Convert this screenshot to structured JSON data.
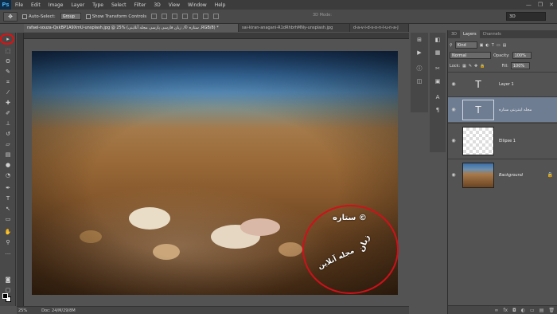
{
  "app": {
    "logo": "Ps"
  },
  "menu": [
    "File",
    "Edit",
    "Image",
    "Layer",
    "Type",
    "Select",
    "Filter",
    "3D",
    "View",
    "Window",
    "Help"
  ],
  "window_controls": [
    "—",
    "❐",
    "✕"
  ],
  "options_bar": {
    "auto_select_label": "Auto-Select:",
    "auto_select_value": "Group",
    "show_transform_label": "Show Transform Controls",
    "mode_3d_label": "3D Mode:",
    "workspace": "3D"
  },
  "tabs": [
    "rafael-souza-QxkBP1A9XmU-unsplash.jpg @ 25% (ستاره ©, زبان فارسی پارسی مجله آنلاینی ,RGB/8) *",
    "sai-kiran-anagani-R1dRhbrhMNy-unsplash.jpg",
    "d-a-v-i-d-s-o-n-l-u-n-a-J"
  ],
  "status_bar": {
    "zoom": "25%",
    "doc": "Doc: 24/M/29/8M"
  },
  "image_text": {
    "top": "ستاره ©",
    "left": "زبان",
    "bottom": "مجله آنلاین"
  },
  "layers_panel": {
    "tabs": [
      "3D",
      "Layers",
      "Channels"
    ],
    "kind_label": "Kind",
    "blend_mode": "Normal",
    "opacity_label": "Opacity:",
    "opacity_value": "100%",
    "lock_label": "Lock:",
    "fill_label": "Fill:",
    "fill_value": "100%",
    "layers": [
      {
        "name": "Layer 1",
        "thumb": "T",
        "selected": false
      },
      {
        "name": "مجله اینترنتی ستاره",
        "thumb": "T",
        "selected": true
      },
      {
        "name": "Ellipse 1",
        "thumb": "",
        "selected": false
      },
      {
        "name": "Background",
        "thumb": "",
        "selected": false
      }
    ],
    "footer_icons": [
      "fx",
      "◘",
      "◐",
      "▭",
      "▤",
      "🗑"
    ]
  },
  "colors": {
    "highlight_ring": "#d0101a",
    "selected_layer": "#6e7d92"
  }
}
